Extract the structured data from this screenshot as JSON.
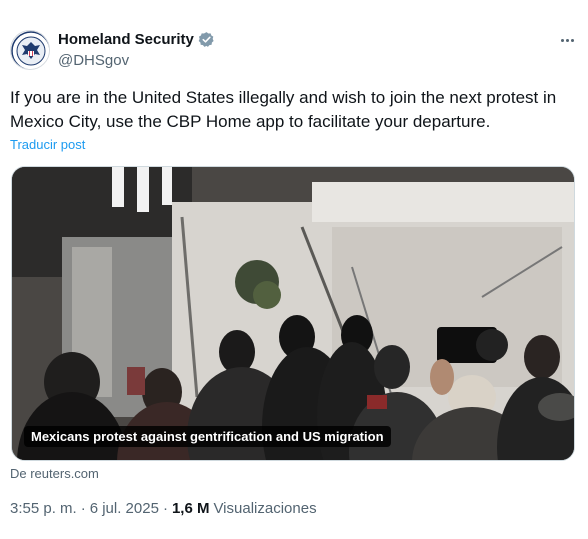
{
  "account": {
    "display_name": "Homeland Security",
    "handle": "@DHSgov",
    "verified_icon": "verified-badge-icon",
    "avatar_icon": "dhs-seal-icon"
  },
  "more_options": {
    "icon": "more-horizontal-icon"
  },
  "tweet": {
    "text": "If you are in the United States illegally and wish to join the next protest in Mexico City, use the CBP Home app to facilitate your departure.",
    "translate_label": "Traducir post"
  },
  "media": {
    "caption": "Mexicans protest against gentrification and US migration",
    "source": "De reuters.com"
  },
  "meta": {
    "time": "3:55 p. m.",
    "separator1": "·",
    "date": "6 jul. 2025",
    "separator2": "·",
    "views_count": "1,6 M",
    "views_label": "Visualizaciones"
  },
  "colors": {
    "link": "#1d9bf0",
    "secondary_text": "#536471",
    "primary_text": "#0f1419",
    "verified_badge": "#829aab"
  }
}
